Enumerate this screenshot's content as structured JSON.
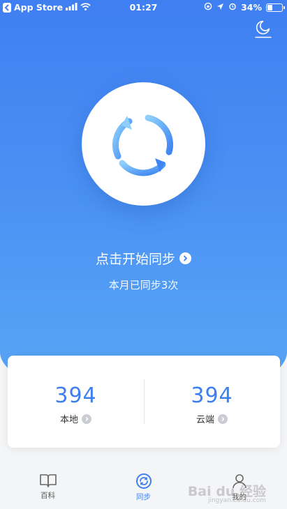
{
  "status_bar": {
    "carrier": "App Store",
    "time": "01:27",
    "battery_text": "34%",
    "battery_level": 0.34
  },
  "sync": {
    "title": "点击开始同步",
    "subtitle": "本月已同步3次"
  },
  "stats": {
    "local": {
      "value": "394",
      "label": "本地"
    },
    "cloud": {
      "value": "394",
      "label": "云端"
    }
  },
  "tabs": [
    {
      "label": "百科",
      "icon": "book-icon",
      "active": false
    },
    {
      "label": "同步",
      "icon": "sync-icon",
      "active": true
    },
    {
      "label": "我的",
      "icon": "person-icon",
      "active": false
    }
  ],
  "watermark": {
    "text": "Bai du 经验",
    "sub": "jingyan.baidu.com"
  },
  "colors": {
    "accent": "#3e7ff0",
    "hero_top": "#3f7ff2",
    "hero_bottom": "#58a7f6"
  }
}
